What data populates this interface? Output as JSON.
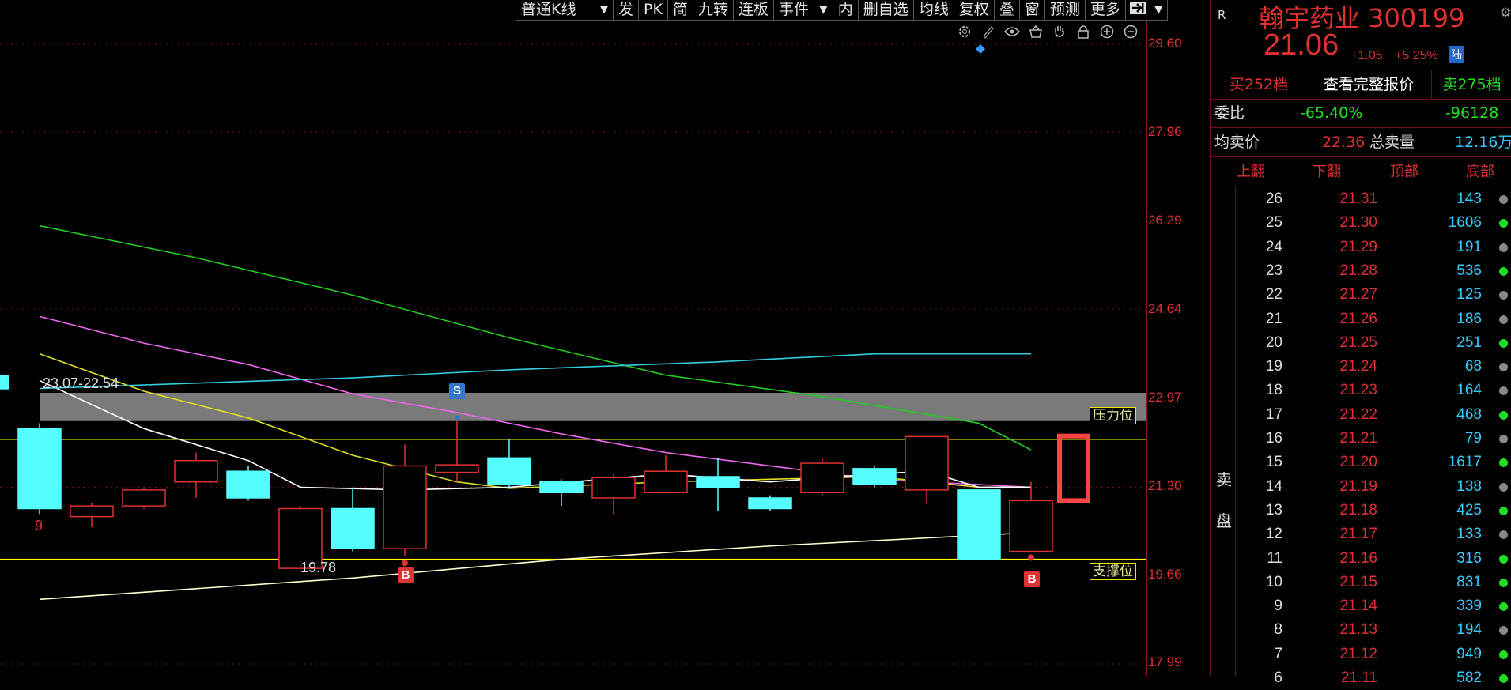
{
  "toolbar": {
    "items": [
      "普通K线",
      "发",
      "PK",
      "简",
      "九转",
      "连板",
      "事件",
      "▼",
      "内",
      "删自选",
      "均线",
      "复权",
      "叠",
      "窗",
      "预测",
      "更多"
    ],
    "dropdown_arrow": "▼",
    "collapse_icon": "pin-right-icon",
    "menu_icon": "caret-down-icon"
  },
  "chart_tools": [
    "settings-icon",
    "draw-pen-icon",
    "eye-icon",
    "basket-icon",
    "hand-icon",
    "lock-icon",
    "zoom-in-icon",
    "zoom-out-icon"
  ],
  "y_axis": {
    "labels": [
      "29.60",
      "27.96",
      "26.29",
      "24.64",
      "22.97",
      "21.30",
      "19.66",
      "17.99"
    ],
    "range": [
      17.99,
      29.6
    ]
  },
  "annotations": {
    "range_label": "23.07-22.54",
    "low_label": "19.78",
    "count_label": "9",
    "resistance": "压力位",
    "support": "支撑位",
    "sell_marker": "S",
    "buy_marker": "B"
  },
  "chart_data": {
    "type": "candlestick",
    "candles": [
      {
        "open": 22.4,
        "close": 20.9,
        "high": 22.5,
        "low": 20.8,
        "color": "cyan"
      },
      {
        "open": 20.75,
        "close": 20.95,
        "high": 21.0,
        "low": 20.55,
        "color": "red"
      },
      {
        "open": 20.95,
        "close": 21.25,
        "high": 21.3,
        "low": 20.9,
        "color": "red"
      },
      {
        "open": 21.4,
        "close": 21.8,
        "high": 21.95,
        "low": 21.1,
        "color": "red"
      },
      {
        "open": 21.6,
        "close": 21.1,
        "high": 21.7,
        "low": 21.05,
        "color": "cyan"
      },
      {
        "open": 19.78,
        "close": 20.9,
        "high": 20.95,
        "low": 19.78,
        "color": "red"
      },
      {
        "open": 20.9,
        "close": 20.15,
        "high": 21.3,
        "low": 20.1,
        "color": "cyan"
      },
      {
        "open": 20.15,
        "close": 21.7,
        "high": 22.1,
        "low": 20.0,
        "color": "red"
      },
      {
        "open": 21.58,
        "close": 21.72,
        "high": 22.6,
        "low": 21.4,
        "color": "red"
      },
      {
        "open": 21.85,
        "close": 21.35,
        "high": 22.2,
        "low": 21.3,
        "color": "cyan"
      },
      {
        "open": 21.4,
        "close": 21.2,
        "high": 21.45,
        "low": 20.95,
        "color": "cyan"
      },
      {
        "open": 21.1,
        "close": 21.48,
        "high": 21.55,
        "low": 20.8,
        "color": "red"
      },
      {
        "open": 21.2,
        "close": 21.6,
        "high": 21.9,
        "low": 21.2,
        "color": "red"
      },
      {
        "open": 21.5,
        "close": 21.3,
        "high": 21.85,
        "low": 20.85,
        "color": "cyan"
      },
      {
        "open": 21.1,
        "close": 20.9,
        "high": 21.15,
        "low": 20.85,
        "color": "cyan"
      },
      {
        "open": 21.2,
        "close": 21.75,
        "high": 21.85,
        "low": 21.15,
        "color": "red"
      },
      {
        "open": 21.65,
        "close": 21.35,
        "high": 21.7,
        "low": 21.3,
        "color": "cyan"
      },
      {
        "open": 21.25,
        "close": 22.25,
        "high": 22.25,
        "low": 21.0,
        "color": "red"
      },
      {
        "open": 21.25,
        "close": 19.95,
        "high": 21.25,
        "low": 19.95,
        "color": "cyan"
      },
      {
        "open": 20.1,
        "close": 21.05,
        "high": 21.4,
        "low": 20.1,
        "color": "red"
      }
    ],
    "ma_lines": [
      {
        "name": "MA-green",
        "color": "#22cc22",
        "points": [
          [
            0,
            26.2
          ],
          [
            3,
            25.6
          ],
          [
            6,
            24.9
          ],
          [
            9,
            24.1
          ],
          [
            12,
            23.4
          ],
          [
            15,
            23.0
          ],
          [
            18,
            22.5
          ],
          [
            19,
            22.0
          ]
        ]
      },
      {
        "name": "MA-pink",
        "color": "#ee66ee",
        "points": [
          [
            0,
            24.5
          ],
          [
            2,
            24.0
          ],
          [
            4,
            23.6
          ],
          [
            6,
            23.05
          ],
          [
            8,
            22.7
          ],
          [
            10,
            22.3
          ],
          [
            12,
            21.95
          ],
          [
            14,
            21.7
          ],
          [
            16,
            21.45
          ],
          [
            18,
            21.35
          ],
          [
            19,
            21.3
          ]
        ]
      },
      {
        "name": "MA-yellow",
        "color": "#dddd22",
        "points": [
          [
            0,
            23.8
          ],
          [
            2,
            23.1
          ],
          [
            4,
            22.6
          ],
          [
            6,
            21.9
          ],
          [
            8,
            21.4
          ],
          [
            9,
            21.28
          ],
          [
            12,
            21.4
          ],
          [
            14,
            21.45
          ],
          [
            16,
            21.5
          ],
          [
            18,
            21.3
          ],
          [
            19,
            21.3
          ]
        ]
      },
      {
        "name": "MA-white",
        "color": "#ffffff",
        "points": [
          [
            0,
            23.3
          ],
          [
            2,
            22.4
          ],
          [
            4,
            21.8
          ],
          [
            5,
            21.3
          ],
          [
            7,
            21.25
          ],
          [
            9,
            21.3
          ],
          [
            12,
            21.55
          ],
          [
            14,
            21.4
          ],
          [
            16,
            21.55
          ],
          [
            17,
            21.6
          ],
          [
            18,
            21.3
          ],
          [
            19,
            21.3
          ]
        ]
      },
      {
        "name": "MA-cyan",
        "color": "#33ccdd",
        "points": [
          [
            0,
            23.15
          ],
          [
            6,
            23.35
          ],
          [
            9,
            23.5
          ],
          [
            13,
            23.65
          ],
          [
            16,
            23.8
          ],
          [
            19,
            23.8
          ]
        ]
      },
      {
        "name": "MA-long",
        "color": "#ffffcc",
        "points": [
          [
            0,
            19.2
          ],
          [
            6,
            19.6
          ],
          [
            10,
            19.95
          ],
          [
            14,
            20.2
          ],
          [
            19,
            20.45
          ]
        ]
      }
    ],
    "pressure_band": [
      22.54,
      23.07
    ],
    "resistance_line": 22.2,
    "support_line": 19.95
  },
  "right_panel": {
    "r_badge": "R",
    "name": "翰宇药业 300199",
    "price": "21.06",
    "change": "+1.05",
    "change_pct": "+5.25%",
    "tag": "陆",
    "tabs": [
      "买252档",
      "查看完整报价",
      "卖275档"
    ],
    "ratio_label": "委比",
    "ratio_value": "-65.40%",
    "ratio_diff": "-96128",
    "avg_label": "均卖价",
    "avg_value": "22.36",
    "total_label": "总卖量",
    "total_value": "12.16万",
    "col_headers": [
      "上翻",
      "下翻",
      "顶部",
      "底部"
    ],
    "side_label": [
      "卖",
      "盘"
    ],
    "book": [
      {
        "level": "26",
        "price": "21.31",
        "vol": "143",
        "dot": "#888888"
      },
      {
        "level": "25",
        "price": "21.30",
        "vol": "1606",
        "dot": "#22dd22"
      },
      {
        "level": "24",
        "price": "21.29",
        "vol": "191",
        "dot": "#888888"
      },
      {
        "level": "23",
        "price": "21.28",
        "vol": "536",
        "dot": "#22dd22"
      },
      {
        "level": "22",
        "price": "21.27",
        "vol": "125",
        "dot": "#888888"
      },
      {
        "level": "21",
        "price": "21.26",
        "vol": "186",
        "dot": "#888888"
      },
      {
        "level": "20",
        "price": "21.25",
        "vol": "251",
        "dot": "#22dd22"
      },
      {
        "level": "19",
        "price": "21.24",
        "vol": "68",
        "dot": "#888888"
      },
      {
        "level": "18",
        "price": "21.23",
        "vol": "164",
        "dot": "#888888"
      },
      {
        "level": "17",
        "price": "21.22",
        "vol": "468",
        "dot": "#22dd22"
      },
      {
        "level": "16",
        "price": "21.21",
        "vol": "79",
        "dot": "#888888"
      },
      {
        "level": "15",
        "price": "21.20",
        "vol": "1617",
        "dot": "#22dd22"
      },
      {
        "level": "14",
        "price": "21.19",
        "vol": "138",
        "dot": "#888888"
      },
      {
        "level": "13",
        "price": "21.18",
        "vol": "425",
        "dot": "#22dd22"
      },
      {
        "level": "12",
        "price": "21.17",
        "vol": "133",
        "dot": "#888888"
      },
      {
        "level": "11",
        "price": "21.16",
        "vol": "316",
        "dot": "#22dd22"
      },
      {
        "level": "10",
        "price": "21.15",
        "vol": "831",
        "dot": "#22dd22"
      },
      {
        "level": "9",
        "price": "21.14",
        "vol": "339",
        "dot": "#22dd22"
      },
      {
        "level": "8",
        "price": "21.13",
        "vol": "194",
        "dot": "#888888"
      },
      {
        "level": "7",
        "price": "21.12",
        "vol": "949",
        "dot": "#22dd22"
      },
      {
        "level": "6",
        "price": "21.11",
        "vol": "582",
        "dot": "#22dd22"
      }
    ]
  },
  "colors": {
    "up": "#e03030",
    "down": "#55ffff",
    "accent": "#ff4444",
    "highlight": "#ffff00"
  }
}
